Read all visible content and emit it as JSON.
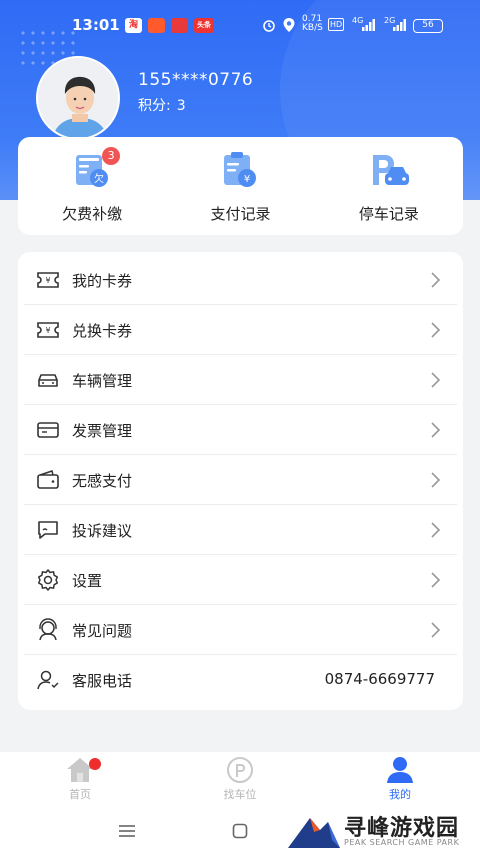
{
  "status_bar": {
    "time": "13:01",
    "apps": [
      "淘",
      "",
      "",
      "头条"
    ],
    "network_speed": "0.71\nKB/S",
    "hd": "HD",
    "signal_1": "4G",
    "signal_2": "2G",
    "battery": "56"
  },
  "profile": {
    "phone": "155****0776",
    "points_label": "积分:",
    "points_value": "3"
  },
  "quick_actions": [
    {
      "label": "欠费补缴",
      "icon": "arrears-icon",
      "badge": "3"
    },
    {
      "label": "支付记录",
      "icon": "payment-record-icon"
    },
    {
      "label": "停车记录",
      "icon": "parking-record-icon"
    }
  ],
  "menu": [
    {
      "label": "我的卡券",
      "icon": "coupon-icon"
    },
    {
      "label": "兑换卡券",
      "icon": "exchange-coupon-icon"
    },
    {
      "label": "车辆管理",
      "icon": "car-icon"
    },
    {
      "label": "发票管理",
      "icon": "invoice-icon"
    },
    {
      "label": "无感支付",
      "icon": "wallet-icon"
    },
    {
      "label": "投诉建议",
      "icon": "feedback-icon"
    },
    {
      "label": "设置",
      "icon": "gear-icon"
    },
    {
      "label": "常见问题",
      "icon": "support-icon"
    },
    {
      "label": "客服电话",
      "icon": "user-phone-icon",
      "value": "0874-6669777"
    }
  ],
  "bottom_nav": [
    {
      "label": "首页",
      "icon": "home-icon"
    },
    {
      "label": "找车位",
      "icon": "parking-p-icon"
    },
    {
      "label": "我的",
      "icon": "person-icon",
      "active": true
    }
  ],
  "watermark": {
    "title": "寻峰游戏园",
    "subtitle": "PEAK SEARCH GAME PARK"
  },
  "colors": {
    "primary": "#2f6bf5",
    "badge": "#f05454",
    "background": "#f2f3f5"
  }
}
